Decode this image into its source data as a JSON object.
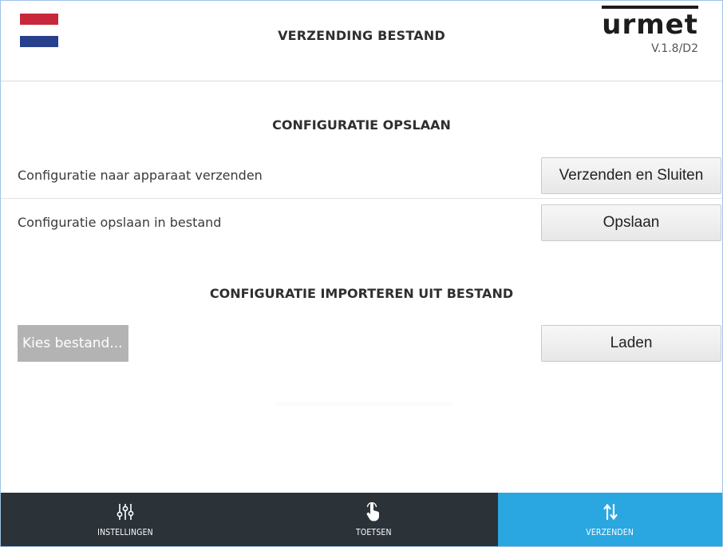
{
  "header": {
    "title": "VERZENDING BESTAND",
    "logo_text": "urmet",
    "version": "V.1.8/D2",
    "flag_colors": [
      "#c8283c",
      "#ffffff",
      "#27408b"
    ]
  },
  "save_section": {
    "title": "CONFIGURATIE OPSLAAN",
    "rows": [
      {
        "label": "Configuratie naar apparaat verzenden",
        "button": "Verzenden en Sluiten"
      },
      {
        "label": "Configuratie opslaan in bestand",
        "button": "Opslaan"
      }
    ]
  },
  "import_section": {
    "title": "CONFIGURATIE IMPORTEREN UIT BESTAND",
    "choose_file": "Kies bestand...",
    "load_button": "Laden"
  },
  "bottom_nav": {
    "items": [
      {
        "label": "INSTELLINGEN",
        "icon": "sliders-icon",
        "active": false
      },
      {
        "label": "TOETSEN",
        "icon": "touch-hand-icon",
        "active": false
      },
      {
        "label": "VERZENDEN",
        "icon": "transfer-arrows-icon",
        "active": true
      }
    ],
    "active_color": "#2aa6e1",
    "bar_color": "#2b3238"
  }
}
